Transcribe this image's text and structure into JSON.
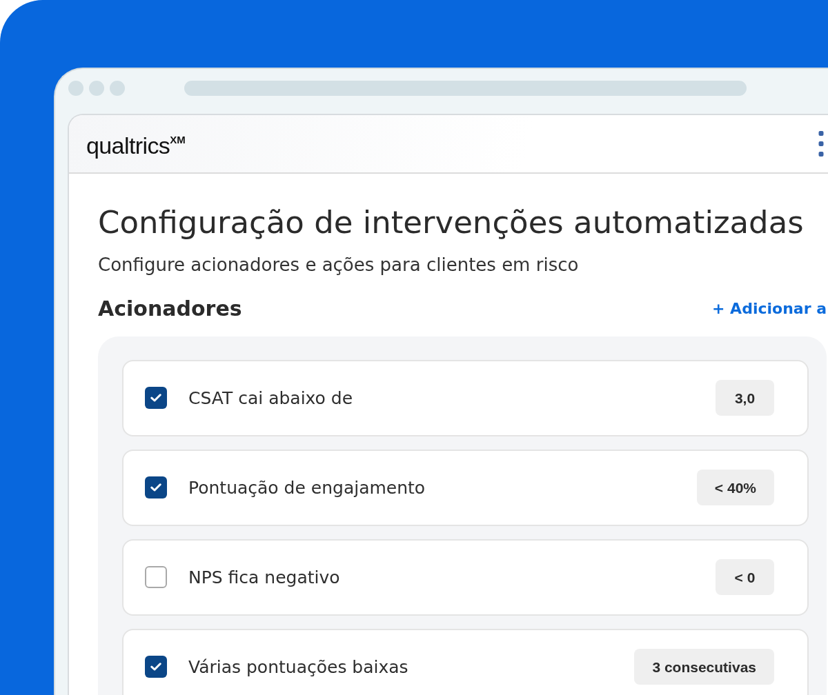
{
  "header": {
    "logo": "qualtrics$^{XM}$"
  },
  "page": {
    "title": "Configuração de intervenções automatizadas",
    "subtitle": "Configure acionadores e ações para clientes em risco"
  },
  "triggers": {
    "heading": "Acionadores",
    "add_link": "+ Adicionar a",
    "items": [
      {
        "label": "CSAT cai abaixo de",
        "checked": true,
        "value": "3,0"
      },
      {
        "label": "Pontuação de engajamento",
        "checked": true,
        "value": "< 40%"
      },
      {
        "label": "NPS fica negativo",
        "checked": false,
        "value": "< 0"
      },
      {
        "label": "Várias pontuações baixas",
        "checked": true,
        "value": "3 consecutivas"
      }
    ]
  }
}
